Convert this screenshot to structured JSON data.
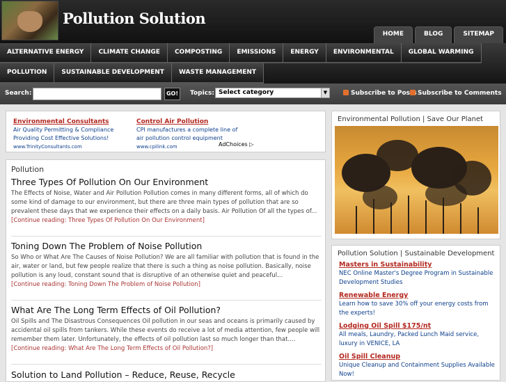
{
  "header": {
    "site_title": "Pollution Solution",
    "logo_icon": "hands-heart-logo-icon",
    "tabs": [
      "HOME",
      "BLOG",
      "SITEMAP"
    ]
  },
  "nav": {
    "row1": [
      "ALTERNATIVE ENERGY",
      "CLIMATE CHANGE",
      "COMPOSTING",
      "EMISSIONS",
      "ENERGY",
      "ENVIRONMENTAL",
      "GLOBAL WARMING"
    ],
    "row2": [
      "POLLUTION",
      "SUSTAINABLE DEVELOPMENT",
      "WASTE MANAGEMENT"
    ]
  },
  "search": {
    "label": "Search:",
    "value": "",
    "go_label": "GO!",
    "topics_label": "Topics:",
    "category_selected": "Select category",
    "subscribe_posts": "Subscribe to Posts",
    "subscribe_comments": "Subscribe to Comments"
  },
  "ads": {
    "items": [
      {
        "title": "Environmental Consultants",
        "desc": "Air Quality Permitting & Compliance Providing Cost Effective Solutions!",
        "url": "www.TrinityConsultants.com"
      },
      {
        "title": "Control Air Pollution",
        "desc": "CPI manufactures a complete line of air pollution control equipment",
        "url": "www.cpilink.com"
      }
    ],
    "adchoices": "AdChoices"
  },
  "main": {
    "category": "Pollution",
    "posts": [
      {
        "title": "Three Types Of Pollution On Our Environment",
        "excerpt": "The Effects of Noise, Water and Air Pollution Pollution comes in many different forms, all of which do some kind of damage to our environment, but there are three main types of pollution that are so prevalent these days that we experience their effects on a daily basis. Air Pollution Of all the types of...",
        "more": "[Continue reading: Three Types Of Pollution On Our Environment]"
      },
      {
        "title": "Toning Down The Problem of Noise Pollution",
        "excerpt": "So Who or What Are The Causes of Noise Pollution? We are all familiar with pollution that is found in the air, water or land, but few people realize that there is such a thing as noise pollution. Basically, noise pollution is any loud, constant sound that is disruptive of an otherwise quiet and peaceful...",
        "more": "[Continue reading: Toning Down The Problem of Noise Pollution]"
      },
      {
        "title": "What Are The Long Term Effects of Oil Pollution?",
        "excerpt": "Oil Spills and The Disastrous Consequences Oil pollution in our seas and oceans is primarily caused by accidental oil spills from tankers. While these events do receive a lot of media attention, few people will remember them later. Unfortunately, the effects of oil pollution last so much longer than that....",
        "more": "[Continue reading: What Are The Long Term Effects of Oil Pollution?]"
      },
      {
        "title": "Solution to Land Pollution – Reduce, Reuse, Recycle",
        "excerpt": "",
        "more": ""
      }
    ]
  },
  "sidebar": {
    "photo_title": "Environmental Pollution | Save Our Planet",
    "ads_title": "Pollution Solution | Sustainable Development",
    "ads": [
      {
        "title": "Masters in Sustainability",
        "desc": "NEC Online Master's Degree Program in Sustainable Development Studies"
      },
      {
        "title": "Renewable Energy",
        "desc": "Learn how to save 30% off your energy costs from the experts!"
      },
      {
        "title": "Lodging Oil Spill $175/nt",
        "desc": "All meals, Laundry, Packed Lunch Maid service, luxury in VENICE, LA"
      },
      {
        "title": "Oil Spill Cleanup",
        "desc": "Unique Cleanup and Containment Supplies Available Now!"
      }
    ]
  },
  "colors": {
    "ad_title": "#b3281f",
    "ad_desc": "#0d3f8c",
    "rss": "#e3702d",
    "more_link": "#a33"
  }
}
